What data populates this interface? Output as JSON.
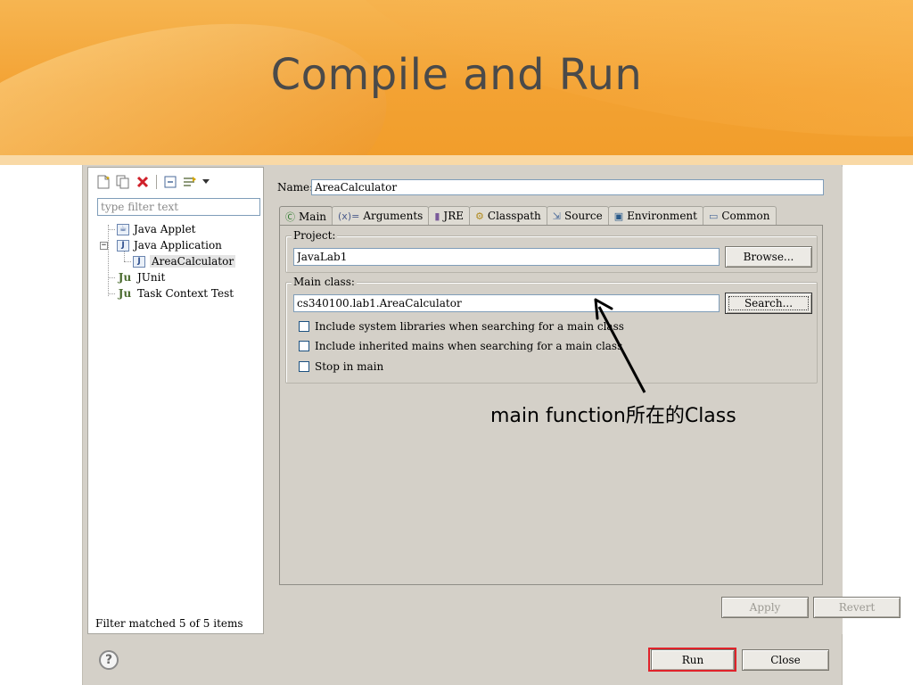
{
  "slide": {
    "title": "Compile and Run",
    "annotation": "main function所在的Class"
  },
  "toolbar": {
    "new_icon": "new-config-icon",
    "duplicate_icon": "duplicate-icon",
    "delete_icon": "delete-icon",
    "collapse_icon": "collapse-all-icon",
    "filter_icon": "filter-icon",
    "dropdown_icon": "chevron-down-icon"
  },
  "filter": {
    "placeholder": "type filter text",
    "status": "Filter matched 5 of 5 items"
  },
  "tree": {
    "items": [
      {
        "label": "Java Applet",
        "icon": "java-applet-icon"
      },
      {
        "label": "Java Application",
        "icon": "java-application-icon",
        "expanded": true
      },
      {
        "label": "AreaCalculator",
        "icon": "java-class-icon",
        "selected": true
      },
      {
        "label": "JUnit",
        "icon": "junit-icon"
      },
      {
        "label": "Task Context Test",
        "icon": "junit-icon"
      }
    ]
  },
  "config": {
    "name_label": "Name:",
    "name_value": "AreaCalculator"
  },
  "tabs": [
    {
      "label": "Main",
      "icon": "main-tab-icon",
      "active": true
    },
    {
      "label": "Arguments",
      "icon": "arguments-icon"
    },
    {
      "label": "JRE",
      "icon": "jre-icon"
    },
    {
      "label": "Classpath",
      "icon": "classpath-icon"
    },
    {
      "label": "Source",
      "icon": "source-icon"
    },
    {
      "label": "Environment",
      "icon": "environment-icon"
    },
    {
      "label": "Common",
      "icon": "common-icon"
    }
  ],
  "main_tab": {
    "project_label": "Project:",
    "project_value": "JavaLab1",
    "browse_label": "Browse...",
    "main_class_label": "Main class:",
    "main_class_value": "cs340100.lab1.AreaCalculator",
    "search_label": "Search...",
    "options": [
      "Include system libraries when searching for a main class",
      "Include inherited mains when searching for a main class",
      "Stop in main"
    ]
  },
  "buttons": {
    "apply": "Apply",
    "revert": "Revert",
    "run": "Run",
    "close": "Close"
  },
  "colors": {
    "header_orange": "#f3a233",
    "highlight_red": "#e0222a",
    "dialog_gray": "#d4d0c8"
  }
}
